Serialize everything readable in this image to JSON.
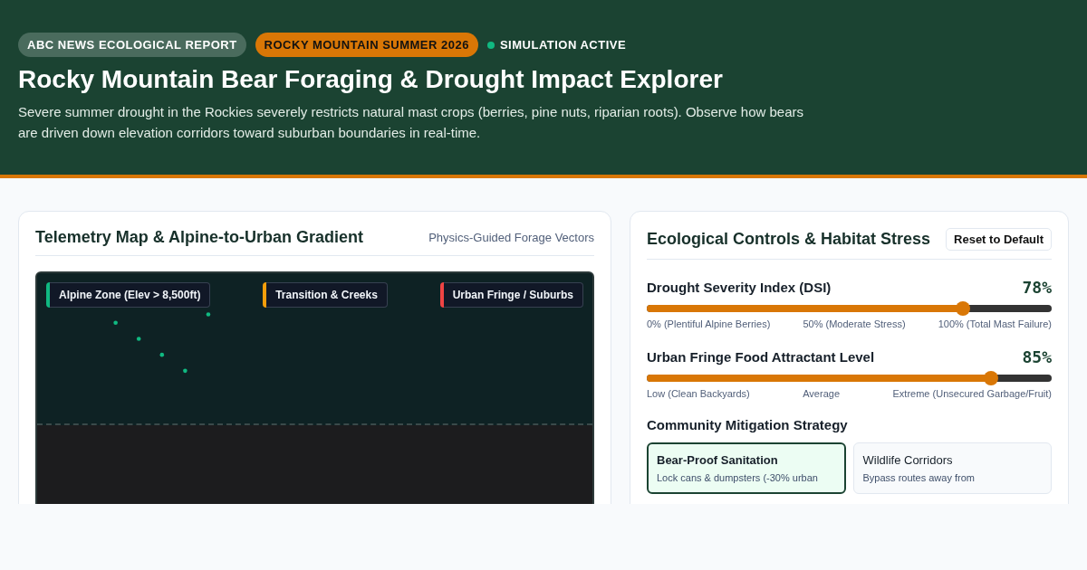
{
  "header": {
    "badges": [
      {
        "label": "ABC NEWS ECOLOGICAL REPORT",
        "kind": "source"
      },
      {
        "label": "ROCKY MOUNTAIN SUMMER 2026",
        "kind": "season"
      }
    ],
    "status": {
      "label": "SIMULATION ACTIVE",
      "color": "#10b981"
    },
    "title": "Rocky Mountain Bear Foraging & Drought Impact Explorer",
    "description": "Severe summer drought in the Rockies severely restricts natural mast crops (berries, pine nuts, riparian roots). Observe how bears are driven down elevation corridors toward suburban boundaries in real-time."
  },
  "map_panel": {
    "title": "Telemetry Map & Alpine-to-Urban Gradient",
    "subtitle": "Physics-Guided Forage Vectors",
    "zones": [
      {
        "label": "Alpine Zone (Elev > 8,500ft)",
        "color": "#10b981"
      },
      {
        "label": "Transition & Creeks",
        "color": "#f59e0b"
      },
      {
        "label": "Urban Fringe / Suburbs",
        "color": "#ef4444"
      }
    ]
  },
  "controls_panel": {
    "title": "Ecological Controls & Habitat Stress",
    "reset_button": "Reset to Default",
    "sliders": [
      {
        "label": "Drought Severity Index (DSI)",
        "reading": "78%",
        "level": 0.78,
        "ticks": [
          "0% (Plentiful Alpine Berries)",
          "50% (Moderate Stress)",
          "100% (Total Mast Failure)"
        ]
      },
      {
        "label": "Urban Fringe Food Attractant Level",
        "reading": "85%",
        "level": 0.85,
        "ticks": [
          "Low (Clean Backyards)",
          "Average",
          "Extreme (Unsecured Garbage/Fruit)"
        ]
      }
    ],
    "strategy_title": "Community Mitigation Strategy",
    "strategies": [
      {
        "title": "Bear-Proof Sanitation",
        "description": "Lock cans & dumpsters (-30% urban",
        "selected": true
      },
      {
        "title": "Wildlife Corridors",
        "description": "Bypass routes away from",
        "selected": false
      }
    ]
  }
}
